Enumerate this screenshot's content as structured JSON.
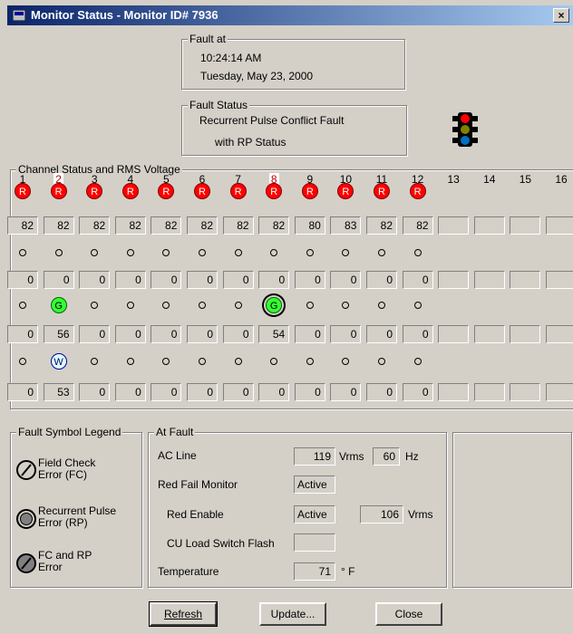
{
  "window": {
    "title": "Monitor Status - Monitor ID# 7936",
    "close_label": "×"
  },
  "fault_at": {
    "label": "Fault at",
    "time": "10:24:14 AM",
    "date": "Tuesday, May 23, 2000"
  },
  "fault_status": {
    "label": "Fault Status",
    "line1": "Recurrent Pulse Conflict Fault",
    "line2": "with RP Status"
  },
  "channel_status": {
    "label": "Channel Status and RMS Voltage",
    "channels": [
      "1",
      "2",
      "3",
      "4",
      "5",
      "6",
      "7",
      "8",
      "9",
      "10",
      "11",
      "12",
      "13",
      "14",
      "15",
      "16"
    ],
    "selected_channels": [
      "2",
      "8"
    ],
    "rows": [
      {
        "lamps": [
          "R",
          "R",
          "R",
          "R",
          "R",
          "R",
          "R",
          "R",
          "R",
          "R",
          "R",
          "R",
          "",
          "",
          "",
          ""
        ],
        "values": [
          "82",
          "82",
          "82",
          "82",
          "82",
          "82",
          "82",
          "82",
          "80",
          "83",
          "82",
          "82",
          "",
          "",
          "",
          ""
        ]
      },
      {
        "lamps": [
          "",
          "",
          "",
          "",
          "",
          "",
          "",
          "",
          "",
          "",
          "",
          "",
          "",
          "",
          "",
          ""
        ],
        "values": [
          "0",
          "0",
          "0",
          "0",
          "0",
          "0",
          "0",
          "0",
          "0",
          "0",
          "0",
          "0",
          "",
          "",
          "",
          ""
        ]
      },
      {
        "lamps": [
          "",
          "G",
          "",
          "",
          "",
          "",
          "",
          "G",
          "",
          "",
          "",
          "",
          "",
          "",
          "",
          ""
        ],
        "values": [
          "0",
          "56",
          "0",
          "0",
          "0",
          "0",
          "0",
          "54",
          "0",
          "0",
          "0",
          "0",
          "",
          "",
          "",
          ""
        ]
      },
      {
        "lamps": [
          "",
          "W",
          "",
          "",
          "",
          "",
          "",
          "",
          "",
          "",
          "",
          "",
          "",
          "",
          "",
          ""
        ],
        "values": [
          "0",
          "53",
          "0",
          "0",
          "0",
          "0",
          "0",
          "0",
          "0",
          "0",
          "0",
          "0",
          "",
          "",
          "",
          ""
        ]
      }
    ]
  },
  "legend": {
    "label": "Fault Symbol Legend",
    "fc": "Field Check Error (FC)",
    "rp": "Recurrent Pulse Error (RP)",
    "fcrp": "FC and RP Error"
  },
  "at_fault": {
    "label": "At Fault",
    "ac_line_label": "AC Line",
    "ac_line_value": "119",
    "vrms_unit": "Vrms",
    "hz_value": "60",
    "hz_unit": "Hz",
    "red_fail_monitor_label": "Red Fail Monitor",
    "red_fail_monitor_value": "Active",
    "red_enable_label": "Red Enable",
    "red_enable_value": "Active",
    "red_enable_voltage": "106",
    "red_enable_unit": "Vrms",
    "cu_load_label": "CU Load Switch Flash",
    "cu_load_value": "",
    "temperature_label": "Temperature",
    "temperature_value": "71",
    "temperature_unit": "° F"
  },
  "buttons": {
    "refresh": "Refresh",
    "update": "Update...",
    "close": "Close"
  },
  "colors": {
    "red_lamp": "#ff0000",
    "green_lamp": "#33ff33",
    "white_lamp": "#e0ffff",
    "title_start": "#0a246a"
  }
}
